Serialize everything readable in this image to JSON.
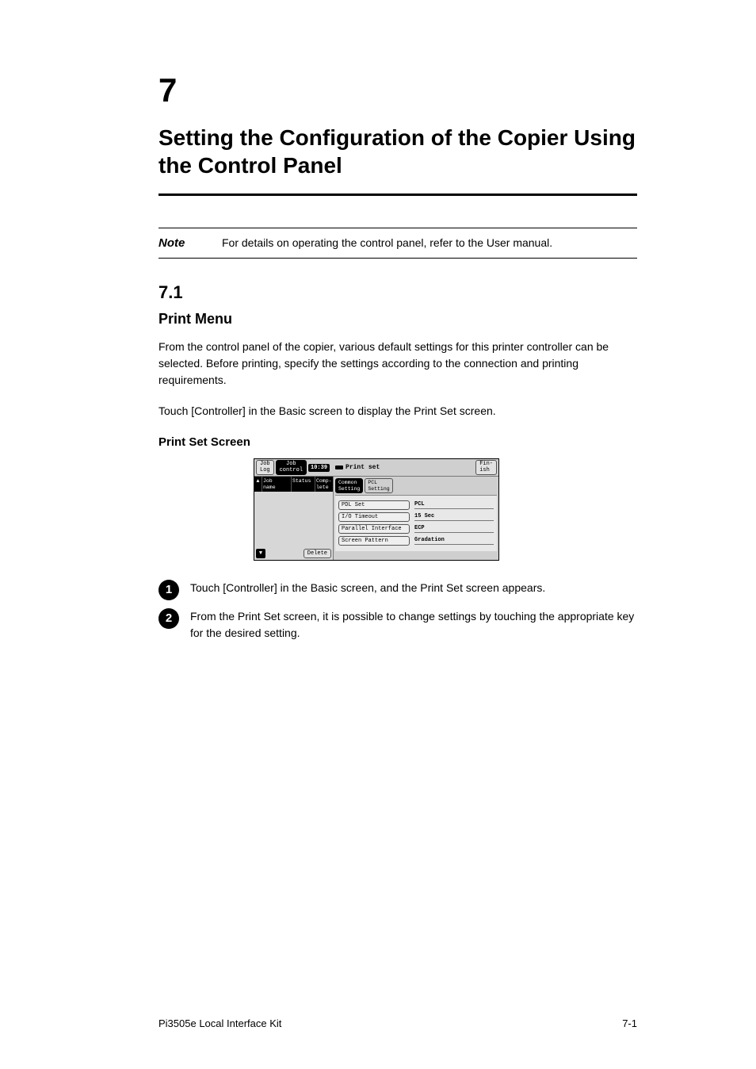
{
  "chapter": {
    "number": "7",
    "title": "Setting the Configuration of the Copier Using the Control Panel"
  },
  "note": {
    "label": "Note",
    "text": "For details on operating the control panel, refer to the User manual."
  },
  "section": {
    "number": "7.1",
    "title": "Print Menu"
  },
  "paragraphs": {
    "p1": "From the control panel of the copier, various default settings for this printer controller can be selected. Before printing, specify the settings according to the connection and printing requirements.",
    "p2": "Touch [Controller] in the Basic screen to display the Print Set screen.",
    "sub": "Print Set Screen"
  },
  "screenshot": {
    "top": {
      "tab_log": "Job\nLog",
      "tab_control": "Job\ncontrol",
      "clock": "10:39",
      "title": "Print set",
      "fin": "Fin-\nish"
    },
    "left": {
      "h_arrow": "▲",
      "h_job": "Job\nname",
      "h_status": "Status",
      "h_comp": "Comp-\nlete",
      "down": "▼",
      "delete": "Delete"
    },
    "right": {
      "tab_common": "Common\nSetting",
      "tab_pcl": "PCL\nSetting",
      "rows": [
        {
          "label": "PDL Set",
          "value": "PCL"
        },
        {
          "label": "I/O Timeout",
          "value": "15  Sec"
        },
        {
          "label": "Parallel Interface",
          "value": "ECP"
        },
        {
          "label": "Screen Pattern",
          "value": "Gradation"
        }
      ]
    }
  },
  "steps": {
    "s1_num": "1",
    "s1_text": "Touch [Controller] in the Basic screen, and the Print Set screen appears.",
    "s2_num": "2",
    "s2_text": "From the Print Set screen, it is possible to change settings by touching the appropriate key for the desired setting."
  },
  "footer": {
    "left": "Pi3505e Local Interface Kit",
    "right": "7-1"
  }
}
